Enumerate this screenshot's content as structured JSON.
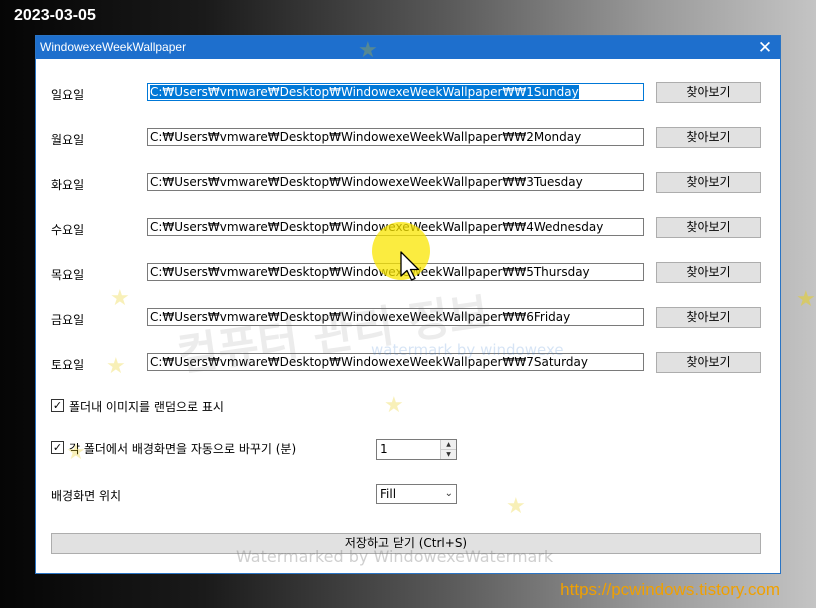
{
  "overlay": {
    "date": "2023-03-05",
    "url": "https://pcwindows.tistory.com"
  },
  "window": {
    "title": "WindowexeWeekWallpaper",
    "close_glyph": "✕"
  },
  "days": [
    {
      "label": "일요일",
      "path": "C:₩Users₩vmware₩Desktop₩WindowexeWeekWallpaper₩₩1Sunday",
      "browse": "찾아보기"
    },
    {
      "label": "월요일",
      "path": "C:₩Users₩vmware₩Desktop₩WindowexeWeekWallpaper₩₩2Monday",
      "browse": "찾아보기"
    },
    {
      "label": "화요일",
      "path": "C:₩Users₩vmware₩Desktop₩WindowexeWeekWallpaper₩₩3Tuesday",
      "browse": "찾아보기"
    },
    {
      "label": "수요일",
      "path": "C:₩Users₩vmware₩Desktop₩WindowexeWeekWallpaper₩₩4Wednesday",
      "browse": "찾아보기"
    },
    {
      "label": "목요일",
      "path": "C:₩Users₩vmware₩Desktop₩WindowexeWeekWallpaper₩₩5Thursday",
      "browse": "찾아보기"
    },
    {
      "label": "금요일",
      "path": "C:₩Users₩vmware₩Desktop₩WindowexeWeekWallpaper₩₩6Friday",
      "browse": "찾아보기"
    },
    {
      "label": "토요일",
      "path": "C:₩Users₩vmware₩Desktop₩WindowexeWeekWallpaper₩₩7Saturday",
      "browse": "찾아보기"
    }
  ],
  "options": {
    "random": {
      "label": "폴더내 이미지를 랜덤으로 표시",
      "checked": true
    },
    "auto_change": {
      "label": "각 폴더에서 배경화면을 자동으로 바꾸기 (분)",
      "checked": true
    },
    "interval_value": "1",
    "position_label": "배경화면 위치",
    "position_value": "Fill"
  },
  "save_label": "저장하고 닫기 (Ctrl+S)",
  "watermarks": {
    "main": "컴퓨터 관리 정보",
    "secondary": "watermark by windowexe",
    "bottom": "Watermarked by WindowexeWatermark"
  }
}
